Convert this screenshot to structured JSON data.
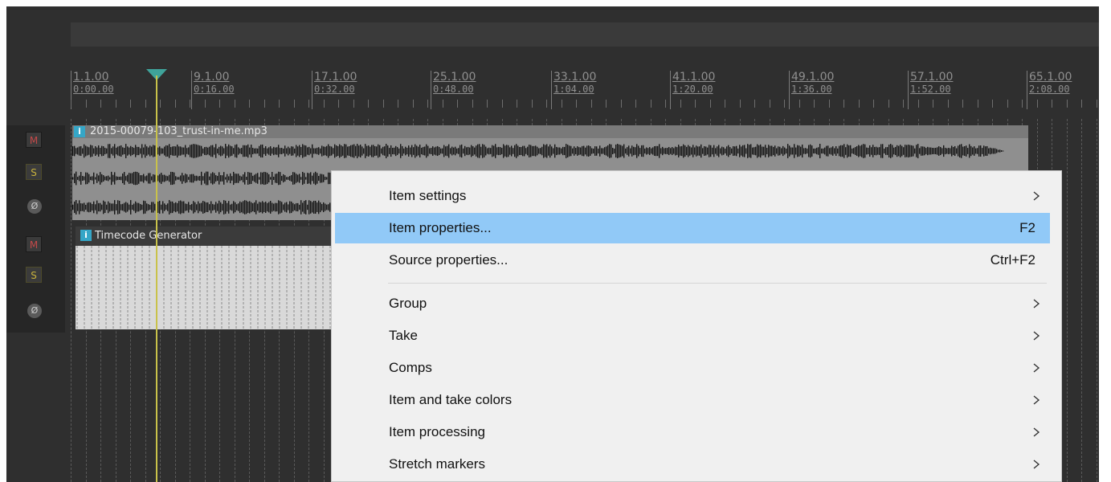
{
  "ruler": {
    "markers": [
      {
        "bar": "1.1.00",
        "time": "0:00.00"
      },
      {
        "bar": "9.1.00",
        "time": "0:16.00"
      },
      {
        "bar": "17.1.00",
        "time": "0:32.00"
      },
      {
        "bar": "25.1.00",
        "time": "0:48.00"
      },
      {
        "bar": "33.1.00",
        "time": "1:04.00"
      },
      {
        "bar": "41.1.00",
        "time": "1:20.00"
      },
      {
        "bar": "49.1.00",
        "time": "1:36.00"
      },
      {
        "bar": "57.1.00",
        "time": "1:52.00"
      },
      {
        "bar": "65.1.00",
        "time": "2:08.00"
      }
    ]
  },
  "tracks": [
    {
      "mute": "M",
      "solo": "S",
      "phase": "Ø"
    },
    {
      "mute": "M",
      "solo": "S",
      "phase": "Ø"
    }
  ],
  "items": {
    "audio": {
      "badge": "i",
      "name": "2015-00079-103_trust-in-me.mp3"
    },
    "timecode": {
      "badge": "i",
      "name": "Timecode Generator"
    }
  },
  "context_menu": {
    "items": [
      {
        "label": "Item settings",
        "shortcut": "",
        "submenu": true,
        "highlighted": false
      },
      {
        "label": "Item properties...",
        "shortcut": "F2",
        "submenu": false,
        "highlighted": true
      },
      {
        "label": "Source properties...",
        "shortcut": "Ctrl+F2",
        "submenu": false,
        "highlighted": false
      },
      {
        "label": "Group",
        "shortcut": "",
        "submenu": true,
        "highlighted": false
      },
      {
        "label": "Take",
        "shortcut": "",
        "submenu": true,
        "highlighted": false
      },
      {
        "label": "Comps",
        "shortcut": "",
        "submenu": true,
        "highlighted": false
      },
      {
        "label": "Item and take colors",
        "shortcut": "",
        "submenu": true,
        "highlighted": false
      },
      {
        "label": "Item processing",
        "shortcut": "",
        "submenu": true,
        "highlighted": false
      },
      {
        "label": "Stretch markers",
        "shortcut": "",
        "submenu": true,
        "highlighted": false
      }
    ]
  },
  "colors": {
    "background": "#2f2f2f",
    "cursor": "#c9c24a",
    "cursor_head": "#3fa39a",
    "menu_highlight": "#91c9f7",
    "info_badge": "#35a6c7",
    "mute": "#c44949",
    "solo": "#c9b23c"
  }
}
